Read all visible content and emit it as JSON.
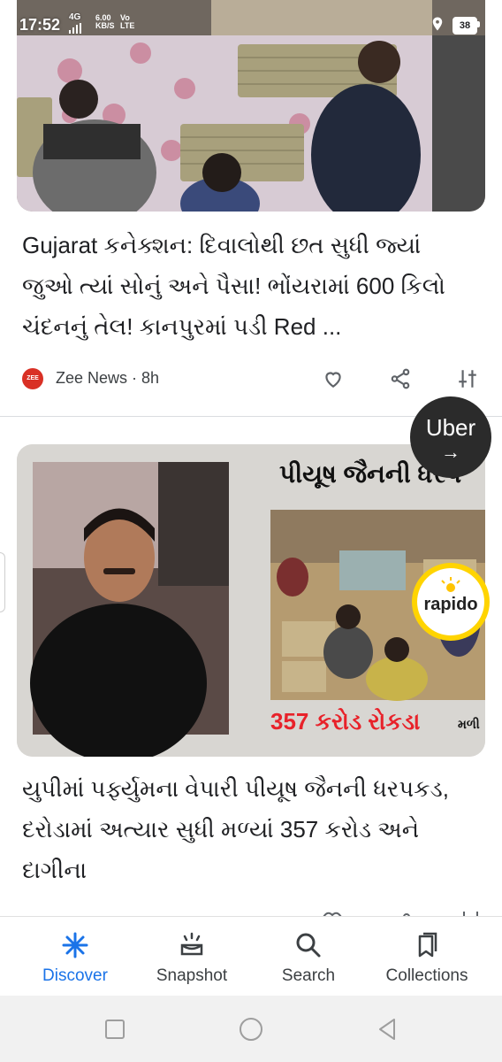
{
  "status_bar": {
    "time": "17:52",
    "network_signal": "4G",
    "speed_value": "6.00",
    "speed_unit": "KB/S",
    "volte_top": "Vo",
    "volte_bottom": "LTE",
    "battery": "38"
  },
  "cards": [
    {
      "headline": "Gujarat કનેક્શન: દિવાલોથી છત સુધી જ્યાં જુઓ ત્યાં સોનું અને પૈસા! ભોંયરામાં 600 કિલો ચંદનનું તેલ! કાનપુરમાં પડી Red ...",
      "source_logo_text": "ZEE",
      "source": "Zee News · 8h"
    },
    {
      "image_title": "પીયૂષ જૈનની ધરપ",
      "image_amount": "357 કરોડ રોકડા",
      "image_amount_suffix": "મળી",
      "headline": "યુપીમાં પર્ફ્યુમના વેપારી પીયૂષ જૈનની ધરપકડ, દરોડામાં અત્યાર સુધી મળ્યાં 357 કરોડ અને દાગીના"
    }
  ],
  "overlays": {
    "uber_label": "Uber",
    "uber_arrow": "→",
    "rapido_label": "rapido"
  },
  "bottom_nav": [
    {
      "label": "Discover",
      "icon": "asterisk-icon",
      "active": true
    },
    {
      "label": "Snapshot",
      "icon": "snapshot-icon",
      "active": false
    },
    {
      "label": "Search",
      "icon": "search-icon",
      "active": false
    },
    {
      "label": "Collections",
      "icon": "collections-icon",
      "active": false
    }
  ],
  "colors": {
    "accent": "#1a73e8",
    "source_logo": "#d93025",
    "promo_red": "#e8222a",
    "rapido_yellow": "#ffd400"
  }
}
